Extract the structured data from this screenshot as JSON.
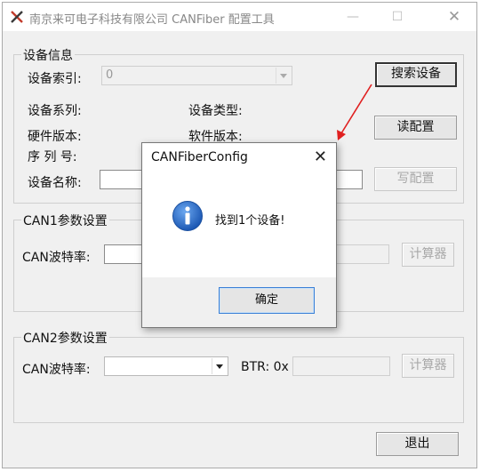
{
  "window": {
    "title": "南京来可电子科技有限公司 CANFiber 配置工具",
    "minimize": "—",
    "maximize": "☐",
    "close": "✕"
  },
  "device_info": {
    "group_title": "设备信息",
    "index_label": "设备索引:",
    "index_value": "0",
    "search_button": "搜索设备",
    "series_label": "设备系列:",
    "type_label": "设备类型:",
    "read_config_button": "读配置",
    "hw_version_label": "硬件版本:",
    "sw_version_label": "软件版本:",
    "serial_label": "序 列 号:",
    "name_label": "设备名称:",
    "write_config_button": "写配置"
  },
  "can1": {
    "group_title": "CAN1参数设置",
    "baud_label": "CAN波特率:",
    "calculator_button": "计算器"
  },
  "can2": {
    "group_title": "CAN2参数设置",
    "baud_label": "CAN波特率:",
    "btr_label": "BTR: 0x",
    "calculator_button": "计算器"
  },
  "exit_button": "退出",
  "dialog": {
    "title": "CANFiberConfig",
    "message": "找到1个设备!",
    "ok_button": "确定",
    "close": "✕",
    "icon": "info-icon"
  },
  "colors": {
    "annotation_arrow": "#e02020",
    "info_icon": "#2a6fc9"
  }
}
